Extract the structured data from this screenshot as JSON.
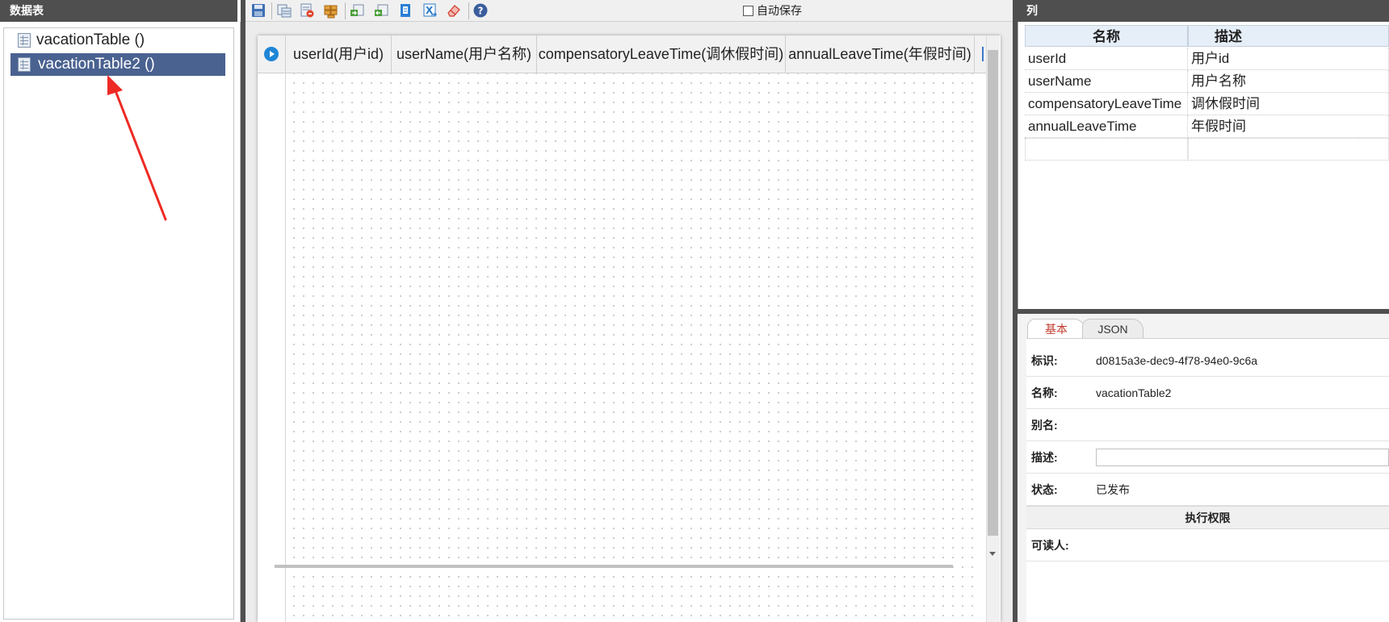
{
  "left_panel": {
    "title": "数据表",
    "tables": [
      {
        "label": "vacationTable ()"
      },
      {
        "label": "vacationTable2 ()",
        "selected": true
      }
    ]
  },
  "toolbar": {
    "autosave_label": "自动保存",
    "autosave_checked": false,
    "icons": [
      "save-icon",
      "copy-table-icon",
      "delete-table-icon",
      "bricks-icon",
      "import-icon",
      "export-icon",
      "document-icon",
      "excel-icon",
      "eraser-icon",
      "help-icon"
    ]
  },
  "grid": {
    "columns": [
      "userId(用户id)",
      "userName(用户名称)",
      "compensatoryLeaveTime(调休假时间)",
      "annualLeaveTime(年假时间)"
    ]
  },
  "columns_panel": {
    "title": "列",
    "headers": {
      "name": "名称",
      "desc": "描述"
    },
    "rows": [
      {
        "name": "userId",
        "desc": "用户id"
      },
      {
        "name": "userName",
        "desc": "用户名称"
      },
      {
        "name": "compensatoryLeaveTime",
        "desc": "调休假时间"
      },
      {
        "name": "annualLeaveTime",
        "desc": "年假时间"
      }
    ]
  },
  "props_panel": {
    "tabs": [
      "基本",
      "JSON"
    ],
    "active_tab": "基本",
    "fields": {
      "id_label": "标识:",
      "id_value": "d0815a3e-dec9-4f78-94e0-9c6a",
      "name_label": "名称:",
      "name_value": "vacationTable2",
      "alias_label": "别名:",
      "desc_label": "描述:",
      "status_label": "状态:",
      "status_value": "已发布",
      "readers_label": "可读人:"
    },
    "permission_section": "执行权限"
  },
  "colors": {
    "accent_selected": "#4a6290",
    "header_dark": "#4f4f4f",
    "tab_active_text": "#c0392b",
    "annotation_arrow": "#ee2a24"
  }
}
